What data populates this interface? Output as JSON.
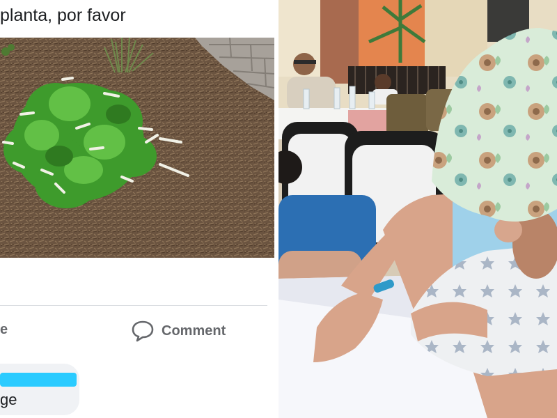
{
  "post": {
    "text": "planta, por favor",
    "actions": {
      "like_partial": "e",
      "comment_label": "Comment"
    },
    "comment": {
      "name_redacted": true,
      "body_partial": "ge"
    }
  },
  "icons": {
    "comment": "comment-icon"
  },
  "colors": {
    "text": "#1c1e21",
    "secondary": "#65676b",
    "redaction": "#1fc8ff",
    "bubble": "#f0f2f5"
  }
}
